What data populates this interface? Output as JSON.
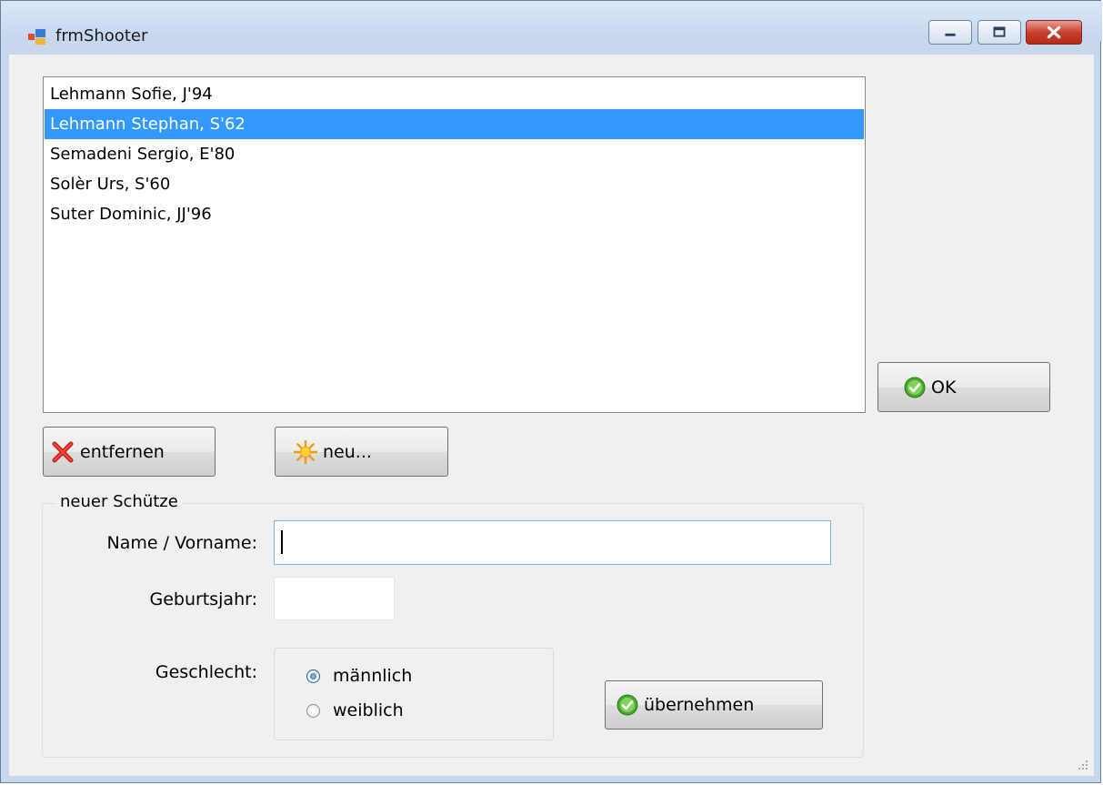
{
  "window": {
    "title": "frmShooter"
  },
  "shooter_list": {
    "items": [
      {
        "label": "Lehmann Sofie, J'94",
        "selected": false
      },
      {
        "label": "Lehmann Stephan, S'62",
        "selected": true
      },
      {
        "label": "Semadeni Sergio, E'80",
        "selected": false
      },
      {
        "label": "Solèr Urs, S'60",
        "selected": false
      },
      {
        "label": "Suter Dominic, JJ'96",
        "selected": false
      }
    ]
  },
  "buttons": {
    "ok": "OK",
    "remove": "entfernen",
    "new": "neu...",
    "apply": "übernehmen"
  },
  "new_shooter": {
    "group_title": "neuer Schütze",
    "name_label": "Name / Vorname:",
    "name_value": "",
    "year_label": "Geburtsjahr:",
    "year_value": "",
    "gender_label": "Geschlecht:",
    "gender_options": [
      {
        "label": "männlich",
        "checked": true
      },
      {
        "label": "weiblich",
        "checked": false
      }
    ]
  },
  "colors": {
    "selection": "#3399ff",
    "dialog_bg": "#f0f0f0",
    "close_red": "#c7402c"
  },
  "icons": {
    "ok": "check-circle-icon",
    "remove": "red-x-icon",
    "new": "starburst-icon",
    "apply": "check-circle-icon"
  }
}
